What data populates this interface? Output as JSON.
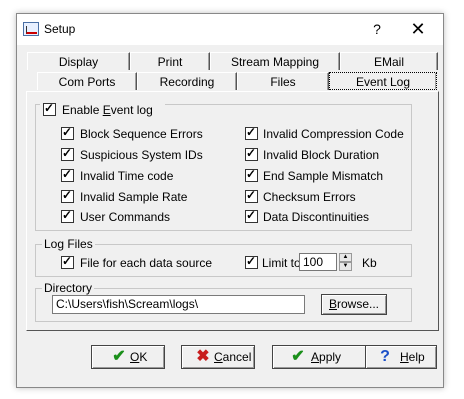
{
  "window": {
    "title": "Setup",
    "help_glyph": "?",
    "close_glyph": "✕"
  },
  "tabs": {
    "row1": [
      "Display",
      "Print",
      "Stream Mapping",
      "EMail"
    ],
    "row2": [
      "Com Ports",
      "Recording",
      "Files",
      "Event Log"
    ],
    "active": "Event Log"
  },
  "event_log": {
    "enable_label_pre": "Enable ",
    "enable_label_key": "E",
    "enable_label_post": "vent log",
    "enable_checked": true,
    "left_options": [
      "Block Sequence Errors",
      "Suspicious System IDs",
      "Invalid Time code",
      "Invalid Sample Rate",
      "User Commands"
    ],
    "right_options": [
      "Invalid Compression Code",
      "Invalid Block Duration",
      "End Sample Mismatch",
      "Checksum Errors",
      "Data Discontinuities"
    ]
  },
  "log_files": {
    "legend": "Log Files",
    "file_per_source_label": "File for each data source",
    "limit_label": "Limit to",
    "limit_value": "100",
    "limit_unit": "Kb"
  },
  "directory": {
    "legend": "Directory",
    "path": "C:\\Users\\fish\\Scream\\logs\\",
    "browse_pre": "",
    "browse_key": "B",
    "browse_post": "rowse..."
  },
  "buttons": {
    "ok": {
      "pre": "",
      "key": "O",
      "post": "K"
    },
    "cancel": {
      "pre": "",
      "key": "C",
      "post": "ancel"
    },
    "apply": {
      "pre": "",
      "key": "A",
      "post": "pply"
    },
    "help": {
      "pre": "",
      "key": "H",
      "post": "elp"
    }
  },
  "colors": {
    "ok_icon": "#1a8f1a",
    "cancel_icon": "#c81e1e",
    "apply_icon": "#1a8f1a",
    "help_icon": "#1a4fc8"
  }
}
